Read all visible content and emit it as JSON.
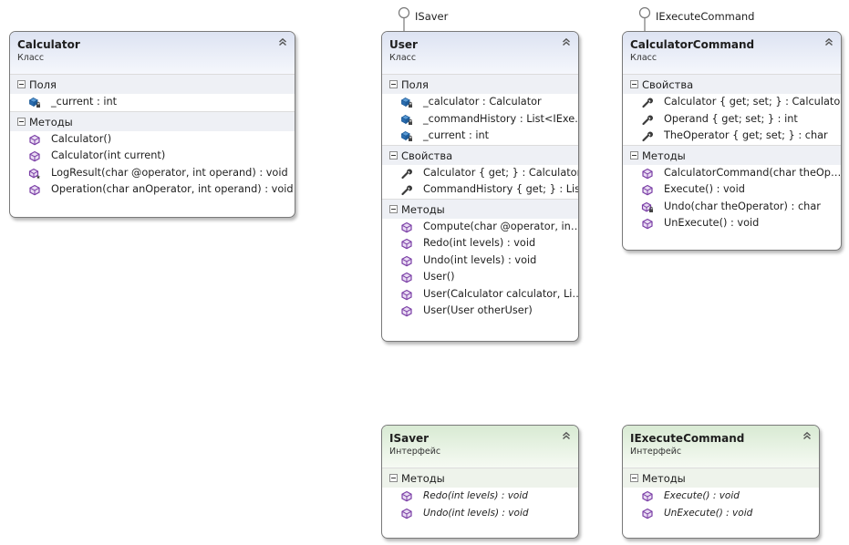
{
  "calculator": {
    "name": "Calculator",
    "stereotype": "Класс",
    "fields_title": "Поля",
    "fields": [
      "_current : int"
    ],
    "methods_title": "Методы",
    "methods": [
      "Calculator()",
      "Calculator(int current)",
      "LogResult(char @operator, int operand) : void",
      "Operation(char anOperator, int operand) : void"
    ]
  },
  "user": {
    "name": "User",
    "stereotype": "Класс",
    "lollipop_label": "ISaver",
    "fields_title": "Поля",
    "fields": [
      "_calculator : Calculator",
      "_commandHistory : List<IExe…",
      "_current : int"
    ],
    "properties_title": "Свойства",
    "properties": [
      "Calculator { get; } : Calculator",
      "CommandHistory { get; } : Lis…"
    ],
    "methods_title": "Методы",
    "methods": [
      "Compute(char @operator, in…",
      "Redo(int levels) : void",
      "Undo(int levels) : void",
      "User()",
      "User(Calculator calculator, Li…",
      "User(User otherUser)"
    ]
  },
  "calculator_command": {
    "name": "CalculatorCommand",
    "stereotype": "Класс",
    "lollipop_label": "IExecuteCommand",
    "properties_title": "Свойства",
    "properties": [
      "Calculator { get; set; } : Calculator",
      "Operand { get; set; } : int",
      "TheOperator { get; set; } : char"
    ],
    "methods_title": "Методы",
    "methods": [
      "CalculatorCommand(char theOp…",
      "Execute() : void",
      "Undo(char theOperator) : char",
      "UnExecute() : void"
    ]
  },
  "isaver": {
    "name": "ISaver",
    "stereotype": "Интерфейс",
    "methods_title": "Методы",
    "methods": [
      "Redo(int levels) : void",
      "Undo(int levels) : void"
    ]
  },
  "iexecute_command": {
    "name": "IExecuteCommand",
    "stereotype": "Интерфейс",
    "methods_title": "Методы",
    "methods": [
      "Execute() : void",
      "UnExecute() : void"
    ]
  },
  "colors": {
    "class_header": "#dde3f2",
    "interface_header": "#d8ead3",
    "method_icon": "#7b3fa6",
    "field_icon": "#2a6db0",
    "property_icon": "#3a3a3a"
  }
}
